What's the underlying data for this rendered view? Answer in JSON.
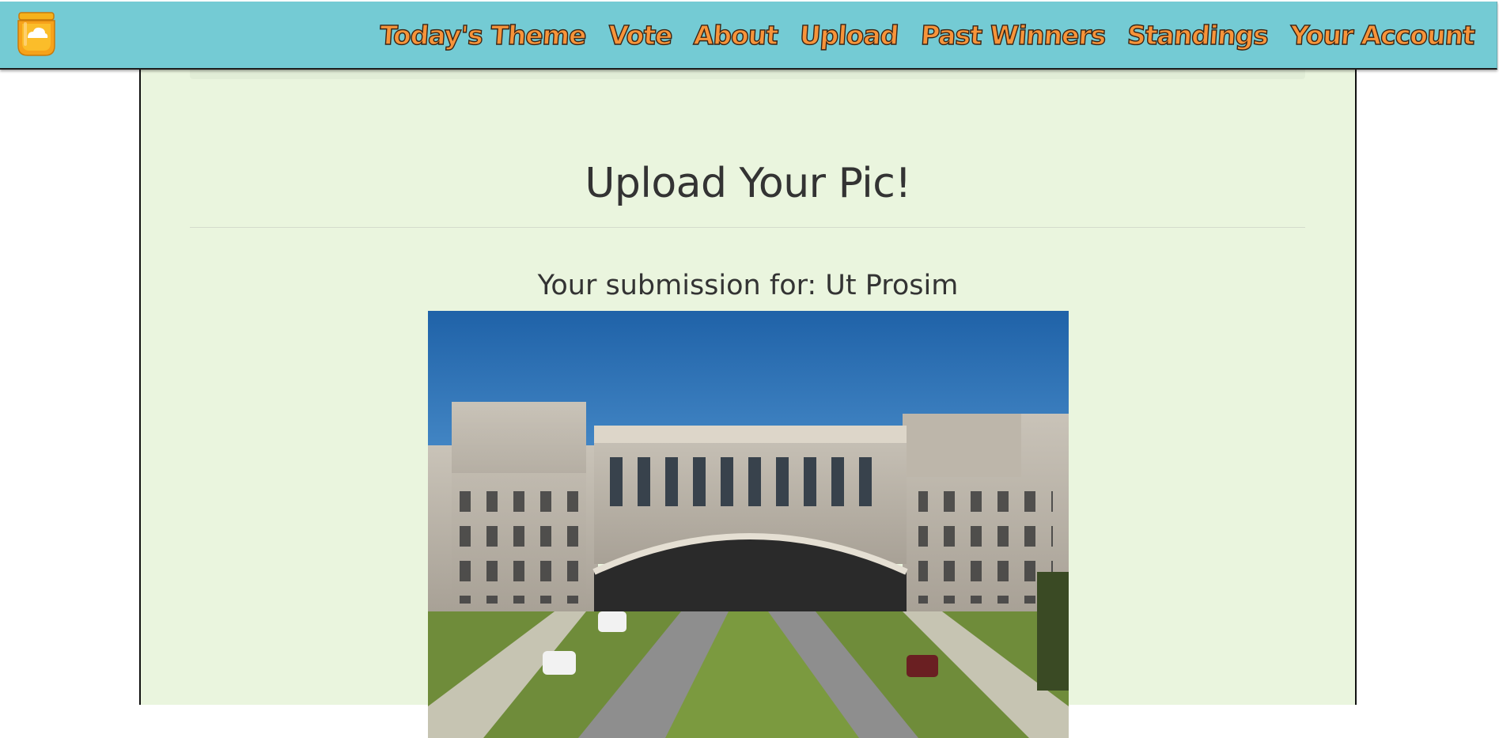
{
  "navbar": {
    "logo_icon": "honey-jar-icon",
    "links": [
      {
        "label": "Today's Theme"
      },
      {
        "label": "Vote"
      },
      {
        "label": "About"
      },
      {
        "label": "Upload"
      },
      {
        "label": "Past Winners"
      },
      {
        "label": "Standings"
      },
      {
        "label": "Your Account"
      }
    ],
    "colors": {
      "bar": "#74cbd4",
      "link": "#f7943a",
      "link_outline": "#3a2414"
    }
  },
  "main": {
    "title": "Upload Your Pic!",
    "submission_label": "Your submission for: Ut Prosim",
    "background": "#eaf5de"
  }
}
